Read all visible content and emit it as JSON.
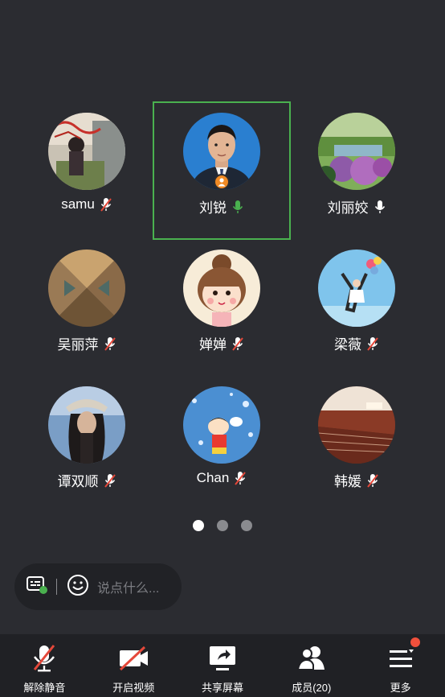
{
  "participants": [
    {
      "name": "samu",
      "mic": "muted",
      "active": false
    },
    {
      "name": "刘锐",
      "mic": "speaking",
      "active": true,
      "host": true
    },
    {
      "name": "刘丽姣",
      "mic": "on",
      "active": false
    },
    {
      "name": "吴丽萍",
      "mic": "muted",
      "active": false
    },
    {
      "name": "婵婵",
      "mic": "muted",
      "active": false
    },
    {
      "name": "梁薇",
      "mic": "muted",
      "active": false
    },
    {
      "name": "谭双顺",
      "mic": "muted",
      "active": false
    },
    {
      "name": "Chan",
      "mic": "muted",
      "active": false
    },
    {
      "name": "韩媛",
      "mic": "muted",
      "active": false
    }
  ],
  "pagination": {
    "total_pages": 3,
    "current_page": 1
  },
  "chat": {
    "placeholder": "说点什么..."
  },
  "toolbar": {
    "unmute_label": "解除静音",
    "video_label": "开启视频",
    "share_label": "共享屏幕",
    "members_label": "成员(20)",
    "more_label": "更多"
  },
  "colors": {
    "background": "#2b2c31",
    "active_border": "#4ab14f",
    "speaking_mic": "#4ab14f",
    "muted_slash": "#e5483a",
    "host_badge": "#f08a24",
    "notify_dot": "#f0503c"
  }
}
